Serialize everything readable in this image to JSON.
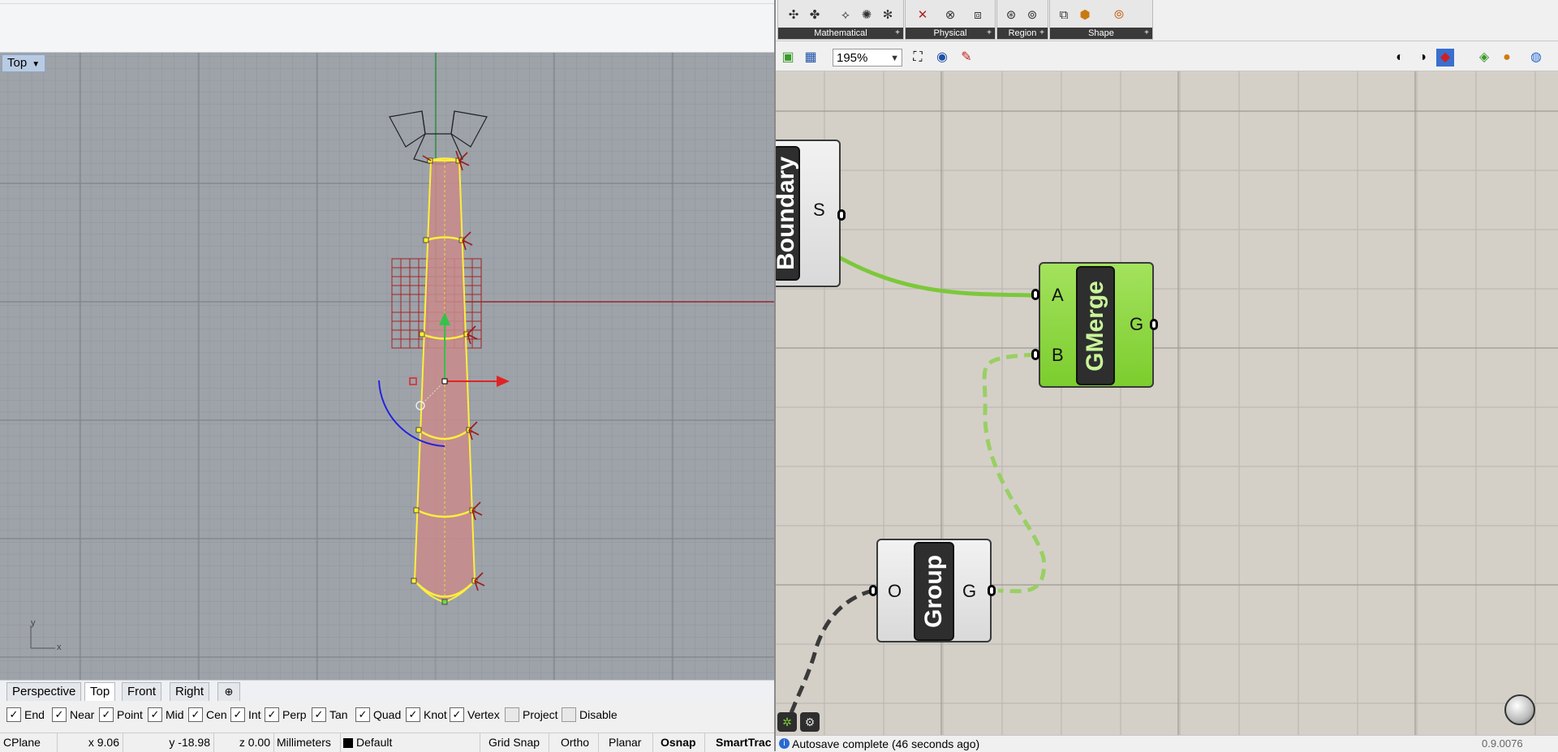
{
  "rhino": {
    "viewport": {
      "title": "Top",
      "axis_x": "x",
      "axis_y": "y"
    },
    "tabs": [
      "Perspective",
      "Top",
      "Front",
      "Right"
    ],
    "active_tab": "Top",
    "add_tab_icon": "add-viewport-icon",
    "osnaps": [
      {
        "label": "End",
        "checked": true
      },
      {
        "label": "Near",
        "checked": true
      },
      {
        "label": "Point",
        "checked": true
      },
      {
        "label": "Mid",
        "checked": true
      },
      {
        "label": "Cen",
        "checked": true
      },
      {
        "label": "Int",
        "checked": true
      },
      {
        "label": "Perp",
        "checked": true
      },
      {
        "label": "Tan",
        "checked": true
      },
      {
        "label": "Quad",
        "checked": true
      },
      {
        "label": "Knot",
        "checked": true
      },
      {
        "label": "Vertex",
        "checked": true
      },
      {
        "label": "Project",
        "checked": false
      },
      {
        "label": "Disable",
        "checked": false
      }
    ],
    "status": {
      "cplane": "CPlane",
      "x": "x 9.06",
      "y": "y -18.98",
      "z": "z 0.00",
      "units": "Millimeters",
      "layer": "Default",
      "grid_snap": "Grid Snap",
      "ortho": "Ortho",
      "planar": "Planar",
      "osnap": "Osnap",
      "smarttrack": "SmartTrac"
    }
  },
  "grasshopper": {
    "ribbon_groups": [
      "Mathematical",
      "Physical",
      "Region",
      "Shape"
    ],
    "zoom": "195%",
    "components": {
      "boundary": {
        "nickname": "Boundary",
        "output": "S"
      },
      "gmerge": {
        "nickname": "GMerge",
        "input_a": "A",
        "input_b": "B",
        "output": "G"
      },
      "group": {
        "nickname": "Group",
        "input": "O",
        "output": "G"
      }
    },
    "status_text": "Autosave complete (46 seconds ago)",
    "version": "0.9.0076"
  },
  "colors": {
    "viewport_bg": "#9ea3aa",
    "tie_fill": "#c98b8b",
    "tie_outline": "#ffef3a",
    "gh_canvas": "#d4d0c8",
    "wire_green": "#7cc83a",
    "gmerge_green": "#8ad53a"
  }
}
